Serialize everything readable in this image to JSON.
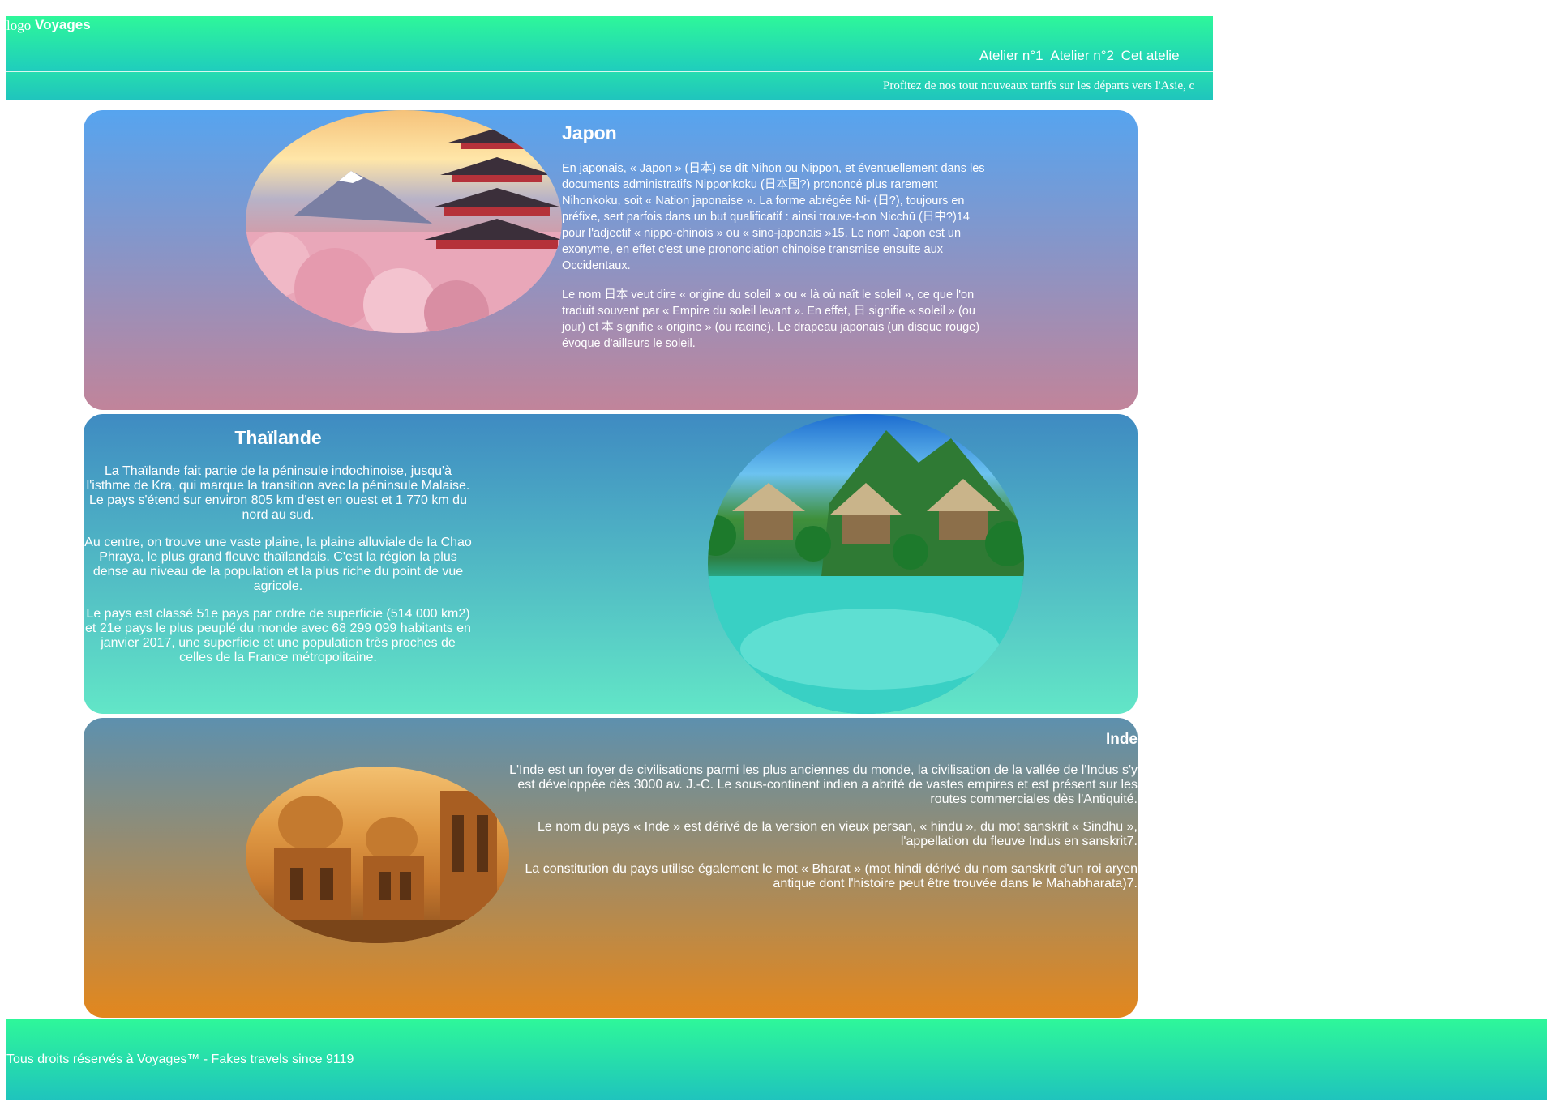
{
  "header": {
    "logo_alt": "logo",
    "brand": "Voyages",
    "nav": [
      "Atelier n°1",
      "Atelier n°2",
      "Cet atelie"
    ]
  },
  "banner": {
    "text": "Profitez de nos tout nouveaux tarifs sur les départs vers l'Asie, c"
  },
  "japon": {
    "title": "Japon",
    "p1": "En japonais, « Japon » (日本) se dit Nihon ou Nippon, et éventuellement dans les documents administratifs Nipponkoku (日本国?) prononcé plus rarement Nihonkoku, soit « Nation japonaise ». La forme abrégée Ni- (日?), toujours en préfixe, sert parfois dans un but qualificatif : ainsi trouve-t-on Nicchū (日中?)14 pour l'adjectif « nippo-chinois » ou « sino-japonais »15. Le nom Japon est un exonyme, en effet c'est une prononciation chinoise transmise ensuite aux Occidentaux.",
    "p2": "Le nom 日本 veut dire « origine du soleil » ou « là où naît le soleil », ce que l'on traduit souvent par « Empire du soleil levant ». En effet, 日 signifie « soleil » (ou jour) et 本 signifie « origine » (ou racine). Le drapeau japonais (un disque rouge) évoque d'ailleurs le soleil."
  },
  "thailande": {
    "title": "Thaïlande",
    "p1": "La Thaïlande fait partie de la péninsule indochinoise, jusqu'à l'isthme de Kra, qui marque la transition avec la péninsule Malaise. Le pays s'étend sur environ 805 km d'est en ouest et 1 770 km du nord au sud.",
    "p2": "Au centre, on trouve une vaste plaine, la plaine alluviale de la Chao Phraya, le plus grand fleuve thaïlandais. C'est la région la plus dense au niveau de la population et la plus riche du point de vue agricole.",
    "p3": "Le pays est classé 51e pays par ordre de superficie (514 000 km2) et 21e pays le plus peuplé du monde avec 68 299 099 habitants en janvier 2017, une superficie et une population très proches de celles de la France métropolitaine."
  },
  "inde": {
    "title": "Inde",
    "p1": "L'Inde est un foyer de civilisations parmi les plus anciennes du monde, la civilisation de la vallée de l'Indus s'y est développée dès 3000 av. J.-C. Le sous-continent indien a abrité de vastes empires et est présent sur les routes commerciales dès l'Antiquité.",
    "p2": "Le nom du pays « Inde » est dérivé de la version en vieux persan, « hindu », du mot sanskrit « Sindhu », l'appellation du fleuve Indus en sanskrit7.",
    "p3": "La constitution du pays utilise également le mot « Bharat » (mot hindi dérivé du nom sanskrit d'un roi aryen antique dont l'histoire peut être trouvée dans le Mahabharata)7."
  },
  "footer": {
    "text": "Tous droits réservés à Voyages™ - Fakes travels since 9119"
  }
}
